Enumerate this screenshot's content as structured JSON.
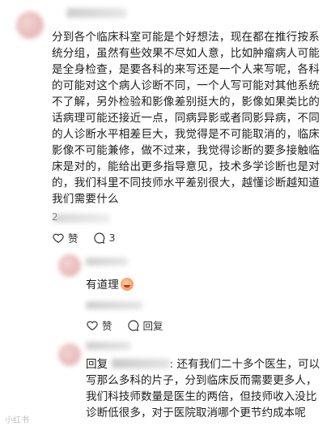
{
  "post": {
    "text": "分到各个临床科室可能是个好想法，现在都在推行按系统分组，虽然有些效果不尽如人意，比如肿瘤病人可能是全身检查，是要各科的来写还是一个人来写呢，各科的可能对这个病人诊断不同，一个人写可能对其他系统不了解，另外检验和影像差别挺大的，影像如果类比的话病理可能还接近一点，同病异影或者同影异病，不同的人诊断水平相差巨大，我觉得是不可能取消的，临床影像不可能兼修，做不过来，我觉得诊断的要多接触临床是对的，能给出更多指导意见，技术多学诊断也是对的，我们科里不同技师水平差别很大，越懂诊断越知道我们需要什么",
    "date_prefix": "2",
    "like_label": "赞",
    "comment_count": "3"
  },
  "reply1": {
    "text": "有道理",
    "like_label": "赞",
    "reply_label": "回复"
  },
  "reply2": {
    "prefix": "回复",
    "text": ": 还有我们二十多个医生，可以写那么多科的片子，分到临床反而需要更多人，我们科技师数量是医生的两倍，但技师收入没比诊断低很多，对于医院取消哪个更节约成本呢"
  },
  "watermark": "小红书"
}
